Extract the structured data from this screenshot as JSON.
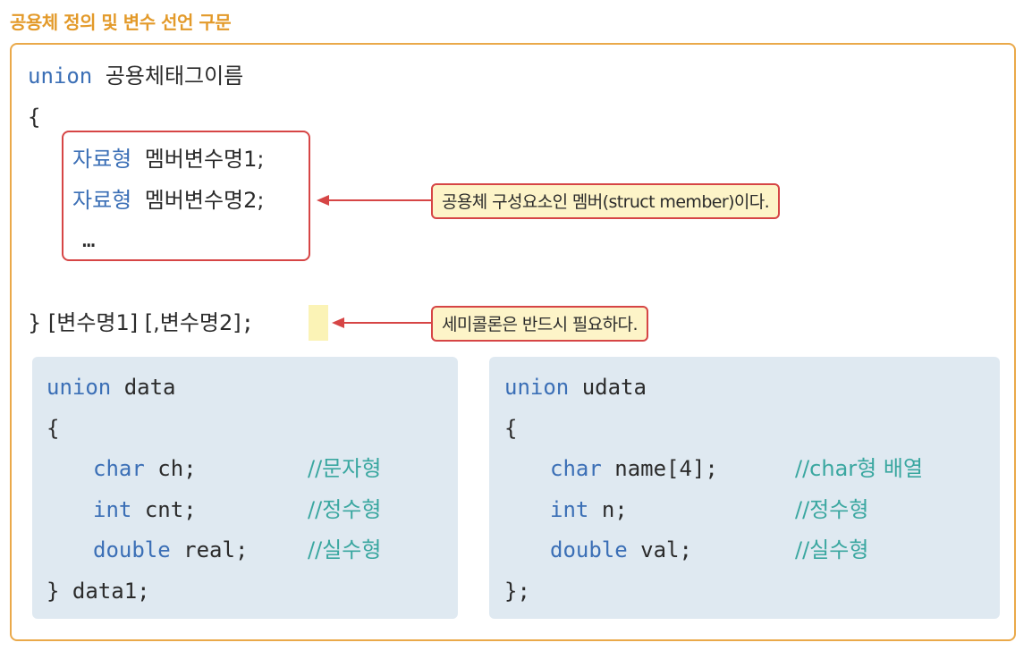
{
  "heading": "공용체 정의 및 변수 선언 구문",
  "syntax": {
    "union_kw": "union",
    "tag_name": "공용체태그이름",
    "open_brace": "{",
    "members": [
      {
        "type": "자료형",
        "name": "멤버변수명1;"
      },
      {
        "type": "자료형",
        "name": "멤버변수명2;"
      }
    ],
    "ellipsis": "…",
    "close_line_pre": "} [변수명1] [,변수명2]",
    "semicolon": ";"
  },
  "callouts": {
    "member_note": "공용체 구성요소인 멤버(struct member)이다.",
    "semicolon_note": "세미콜론은 반드시 필요하다."
  },
  "example_left": {
    "union_kw": "union",
    "tag": "data",
    "open": "{",
    "fields": [
      {
        "type": "char",
        "decl": "ch;",
        "comment": "//문자형"
      },
      {
        "type": "int",
        "decl": "cnt;",
        "comment": "//정수형"
      },
      {
        "type": "double",
        "decl": "real;",
        "comment": "//실수형"
      }
    ],
    "close": "} data1;"
  },
  "example_right": {
    "union_kw": "union",
    "tag": "udata",
    "open": "{",
    "fields": [
      {
        "type": "char",
        "decl": "name[4];",
        "comment": "//char형 배열"
      },
      {
        "type": "int",
        "decl": "n;",
        "comment": "//정수형"
      },
      {
        "type": "double",
        "decl": "val;",
        "comment": "//실수형"
      }
    ],
    "close": "};"
  },
  "colors": {
    "heading": "#e39a2a",
    "frame": "#eaa94a",
    "keyword": "#3b6fb6",
    "comment": "#3aa7a0",
    "callout_border": "#d64545",
    "callout_fill": "#fdf4c8",
    "panel": "#dfe9f1"
  }
}
